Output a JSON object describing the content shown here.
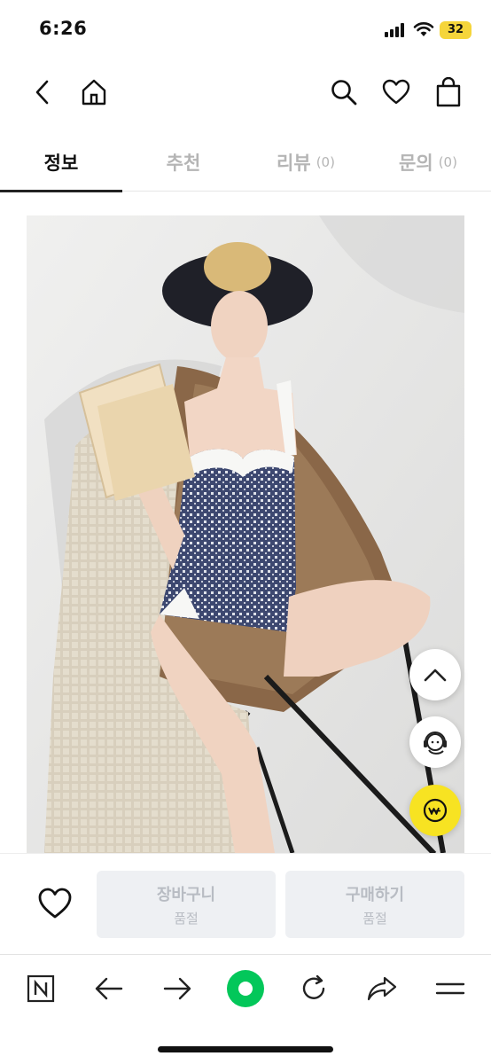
{
  "status_bar": {
    "time": "6:26",
    "battery": "32"
  },
  "tabs": [
    {
      "label": "정보",
      "count": ""
    },
    {
      "label": "추천",
      "count": ""
    },
    {
      "label": "리뷰",
      "count": "(0)"
    },
    {
      "label": "문의",
      "count": "(0)"
    }
  ],
  "purchase_bar": {
    "cart_label": "장바구니",
    "cart_status": "품절",
    "buy_label": "구매하기",
    "buy_status": "품절"
  },
  "icons": {
    "header": [
      "back-arrow-icon",
      "home-icon",
      "search-icon",
      "heart-icon",
      "shopping-bag-icon"
    ],
    "floating": [
      "chevron-up-icon",
      "customer-service-icon",
      "pay-icon"
    ],
    "browser": [
      "naver-logo-icon",
      "back-arrow-icon",
      "forward-arrow-icon",
      "green-circle-icon",
      "refresh-icon",
      "share-icon",
      "menu-icon"
    ]
  },
  "colors": {
    "accent_yellow": "#f7e322",
    "naver_green": "#03c75a",
    "disabled_text": "#b8bcc3"
  }
}
